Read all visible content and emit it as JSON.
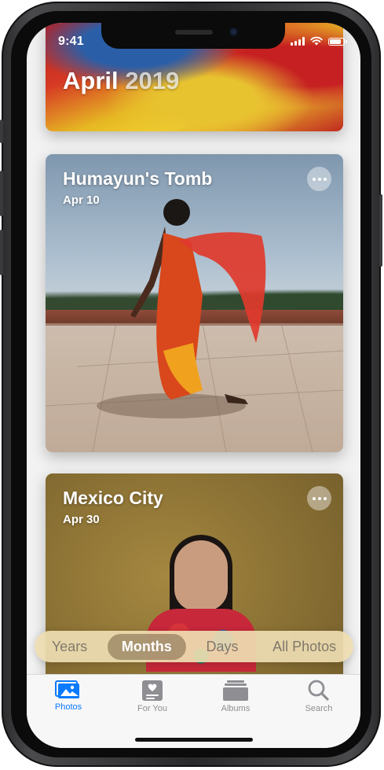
{
  "status_bar": {
    "time": "9:41",
    "battery_level": 0.9
  },
  "cards": [
    {
      "title_month": "April",
      "title_year": "2019"
    },
    {
      "title": "Humayun's Tomb",
      "date": "Apr 10"
    },
    {
      "title": "Mexico City",
      "date": "Apr 30"
    }
  ],
  "view_selector": {
    "options": [
      "Years",
      "Months",
      "Days",
      "All Photos"
    ],
    "selected": "Months"
  },
  "tab_bar": {
    "items": [
      {
        "label": "Photos",
        "icon": "photos-icon",
        "active": true
      },
      {
        "label": "For You",
        "icon": "for-you-icon",
        "active": false
      },
      {
        "label": "Albums",
        "icon": "albums-icon",
        "active": false
      },
      {
        "label": "Search",
        "icon": "search-icon",
        "active": false
      }
    ]
  },
  "colors": {
    "accent": "#0a7aff",
    "inactive": "#8e8e93"
  }
}
